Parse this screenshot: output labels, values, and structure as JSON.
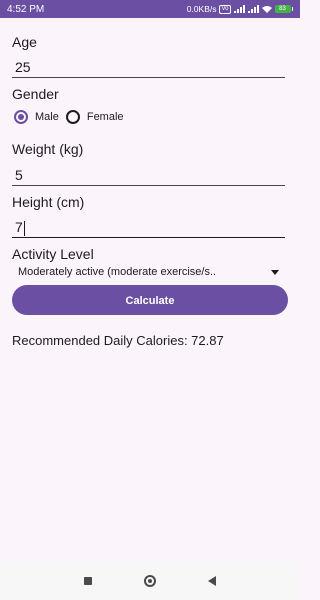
{
  "status_bar": {
    "time": "4:52 PM",
    "network_speed": "0.0KB/s",
    "vo_badge": "Vo",
    "lte_badge": "LTE",
    "battery_level": "83"
  },
  "form": {
    "age": {
      "label": "Age",
      "value": "25"
    },
    "gender": {
      "label": "Gender",
      "options": [
        {
          "label": "Male",
          "selected": true
        },
        {
          "label": "Female",
          "selected": false
        }
      ]
    },
    "weight": {
      "label": "Weight (kg)",
      "value": "5"
    },
    "height": {
      "label": "Height (cm)",
      "value": "7"
    },
    "activity_level": {
      "label": "Activity Level",
      "selected": "Moderately active (moderate exercise/s.."
    }
  },
  "calculate_button": {
    "label": "Calculate"
  },
  "result": {
    "text": "Recommended Daily Calories: 72.87"
  },
  "colors": {
    "primary": "#6a4fa3",
    "background": "#fcf4fb"
  },
  "nav_bar": {
    "icons": [
      "recents-square-icon",
      "home-circle-icon",
      "back-triangle-icon"
    ]
  }
}
